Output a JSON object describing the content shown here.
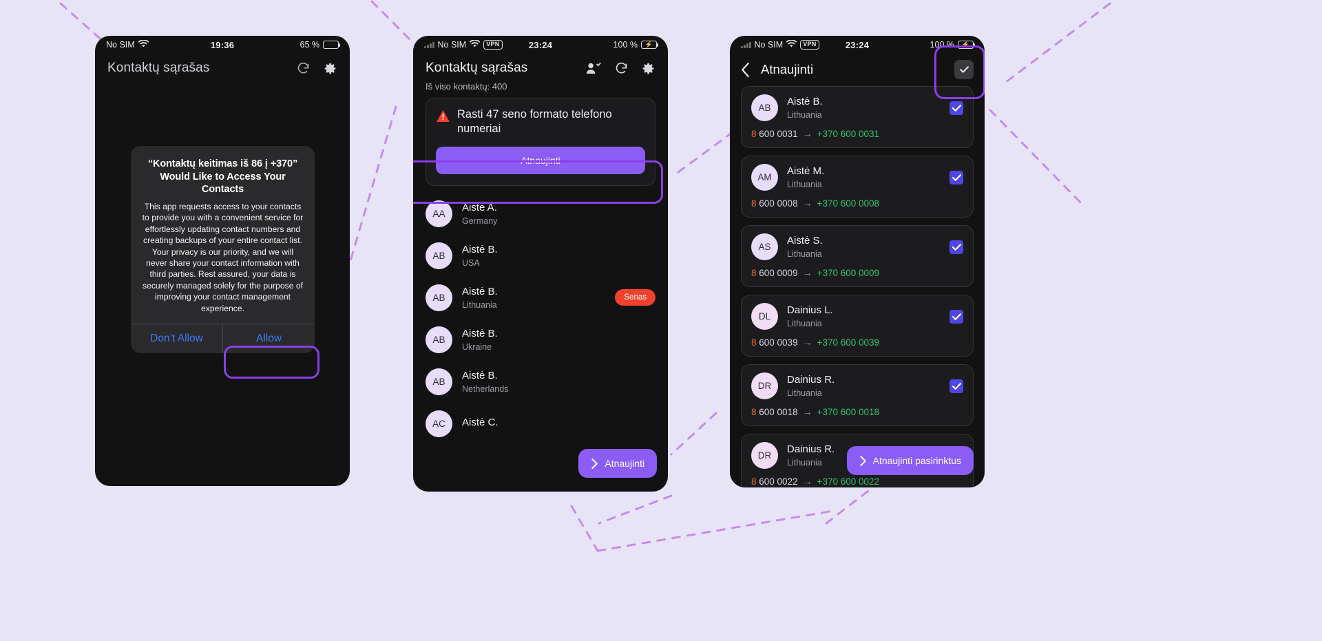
{
  "background": {
    "color": "#e8e4f8",
    "accent": "#8b3ee8"
  },
  "phone1": {
    "status": {
      "carrier": "No SIM",
      "time": "19:36",
      "battery_text": "65 %"
    },
    "header": {
      "title": "Kontaktų sąrašas",
      "refresh_icon": "refresh-icon",
      "settings_icon": "gear-icon"
    },
    "dialog": {
      "title": "“Kontaktų keitimas iš 86 į +370” Would Like to Access Your Contacts",
      "message": "This app requests access to your contacts to provide you with a convenient service for effortlessly updating contact numbers and creating backups of your entire contact list. Your privacy is our priority, and we will never share your contact information with third parties. Rest assured, your data is securely managed solely for the purpose of improving your contact management experience.",
      "deny_label": "Don’t Allow",
      "allow_label": "Allow"
    }
  },
  "phone2": {
    "status": {
      "carrier": "No SIM",
      "vpn": "VPN",
      "time": "23:24",
      "battery_text": "100 %"
    },
    "header": {
      "title": "Kontaktų sąrašas",
      "contacts_icon": "contacts-add-icon",
      "refresh_icon": "refresh-icon",
      "settings_icon": "gear-icon"
    },
    "total_label": "Iš viso kontaktų: 400",
    "warning": {
      "icon": "warning-triangle-icon",
      "text": "Rasti 47 seno formato telefono numeriai",
      "action_label": "Atnaujinti"
    },
    "contacts": [
      {
        "initials": "AA",
        "name": "Aistė A.",
        "country": "Germany",
        "badge": ""
      },
      {
        "initials": "AB",
        "name": "Aistė B.",
        "country": "USA",
        "badge": ""
      },
      {
        "initials": "AB",
        "name": "Aistė B.",
        "country": "Lithuania",
        "badge": "Senas"
      },
      {
        "initials": "AB",
        "name": "Aistė B.",
        "country": "Ukraine",
        "badge": ""
      },
      {
        "initials": "AB",
        "name": "Aistė B.",
        "country": "Netherlands",
        "badge": ""
      },
      {
        "initials": "AC",
        "name": "Aistė C.",
        "country": "",
        "badge": ""
      }
    ],
    "fab_label": "Atnaujinti",
    "fab_icon": "chevron-right-icon"
  },
  "phone3": {
    "status": {
      "carrier": "No SIM",
      "vpn": "VPN",
      "time": "23:24",
      "battery_text": "100 %"
    },
    "header": {
      "back_icon": "back-chevron-icon",
      "title": "Atnaujinti",
      "select_all_icon": "checkbox-checked-icon"
    },
    "items": [
      {
        "initials": "AB",
        "name": "Aistė B.",
        "country": "Lithuania",
        "old": "8 600 0031",
        "new": "+370 600 0031",
        "checked": true
      },
      {
        "initials": "AM",
        "name": "Aistė M.",
        "country": "Lithuania",
        "old": "8 600 0008",
        "new": "+370 600 0008",
        "checked": true
      },
      {
        "initials": "AS",
        "name": "Aistė S.",
        "country": "Lithuania",
        "old": "8 600 0009",
        "new": "+370 600 0009",
        "checked": true
      },
      {
        "initials": "DL",
        "name": "Dainius L.",
        "country": "Lithuania",
        "old": "8 600 0039",
        "new": "+370 600 0039",
        "checked": true
      },
      {
        "initials": "DR",
        "name": "Dainius R.",
        "country": "Lithuania",
        "old": "8 600 0018",
        "new": "+370 600 0018",
        "checked": true
      },
      {
        "initials": "DR",
        "name": "Dainius R.",
        "country": "Lithuania",
        "old": "8 600 0022",
        "new": "+370 600 0022",
        "checked": true
      }
    ],
    "fab_label": "Atnaujinti pasirinktus",
    "fab_icon": "chevron-right-icon",
    "arrow_glyph": "→",
    "old_prefix_color": "#ef6a2a",
    "new_number_color": "#32c36c"
  }
}
